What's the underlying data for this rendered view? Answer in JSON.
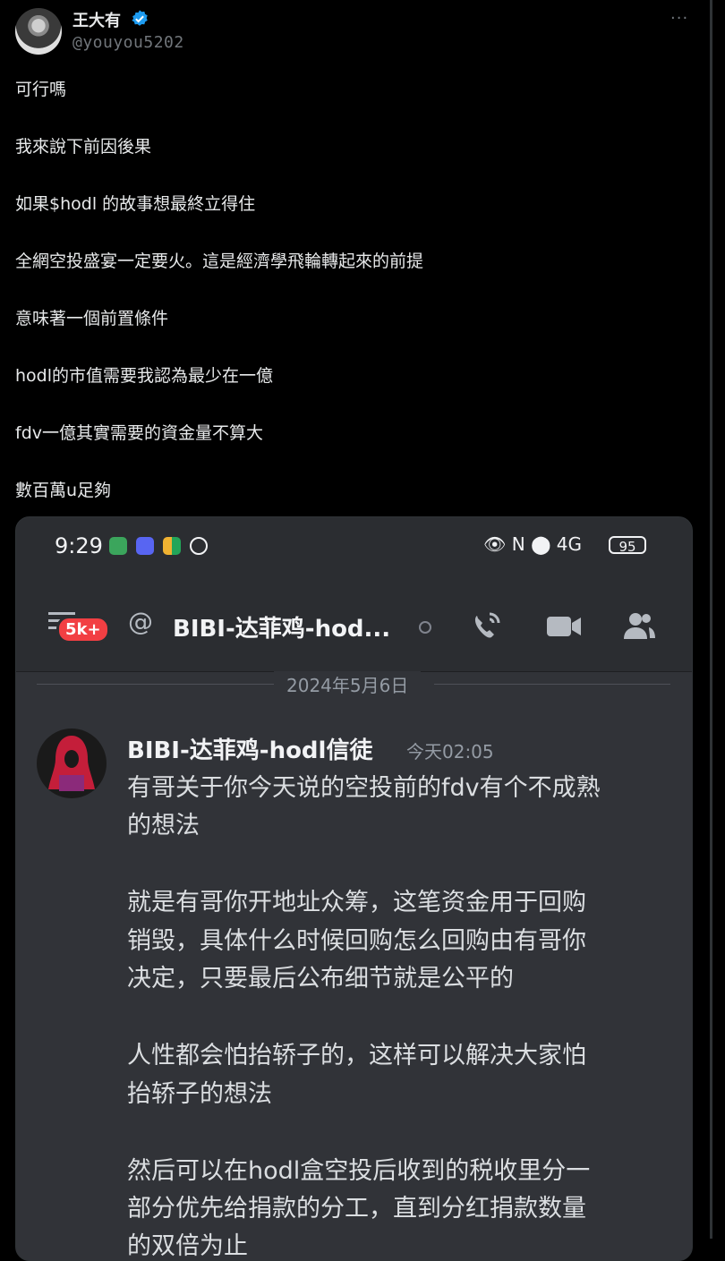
{
  "tweet": {
    "author_name": "王大有",
    "handle": "@youyou5202",
    "more_label": "···",
    "lines": [
      "可行嗎",
      "我來說下前因後果",
      "如果$hodl 的故事想最終立得住",
      "全網空投盛宴一定要火。這是經濟學飛輪轉起來的前提",
      "意味著一個前置條件",
      "hodl的市值需要我認為最少在一億",
      "fdv一億其實需要的資金量不算大",
      "數百萬u足夠"
    ]
  },
  "phone": {
    "status_bar": {
      "time": "9:29",
      "right_icons": "👁 N ⬤ 4G",
      "battery": "95"
    },
    "channel": {
      "badge": "5k+",
      "at_symbol": "@",
      "name": "BIBI-达菲鸡-hod...",
      "icons": [
        "phone-call-icon",
        "video-camera-icon",
        "members-icon"
      ]
    },
    "date_divider": "2024年5月6日",
    "message": {
      "author": "BIBI-达菲鸡-hodl信徒",
      "time": "今天02:05",
      "lines": [
        "有哥关于你今天说的空投前的fdv有个不成熟",
        "的想法",
        "",
        "就是有哥你开地址众筹，这笔资金用于回购",
        "销毁，具体什么时候回购怎么回购由有哥你",
        "决定，只要最后公布细节就是公平的",
        "",
        "人性都会怕抬轿子的，这样可以解决大家怕",
        "抬轿子的想法",
        "",
        "然后可以在hodl盒空投后收到的税收里分一",
        "部分优先给捐款的分工，直到分红捐款数量",
        "的双倍为止"
      ]
    }
  },
  "colors": {
    "accent": "#1d9bf0",
    "discord_red": "#f23f43"
  }
}
